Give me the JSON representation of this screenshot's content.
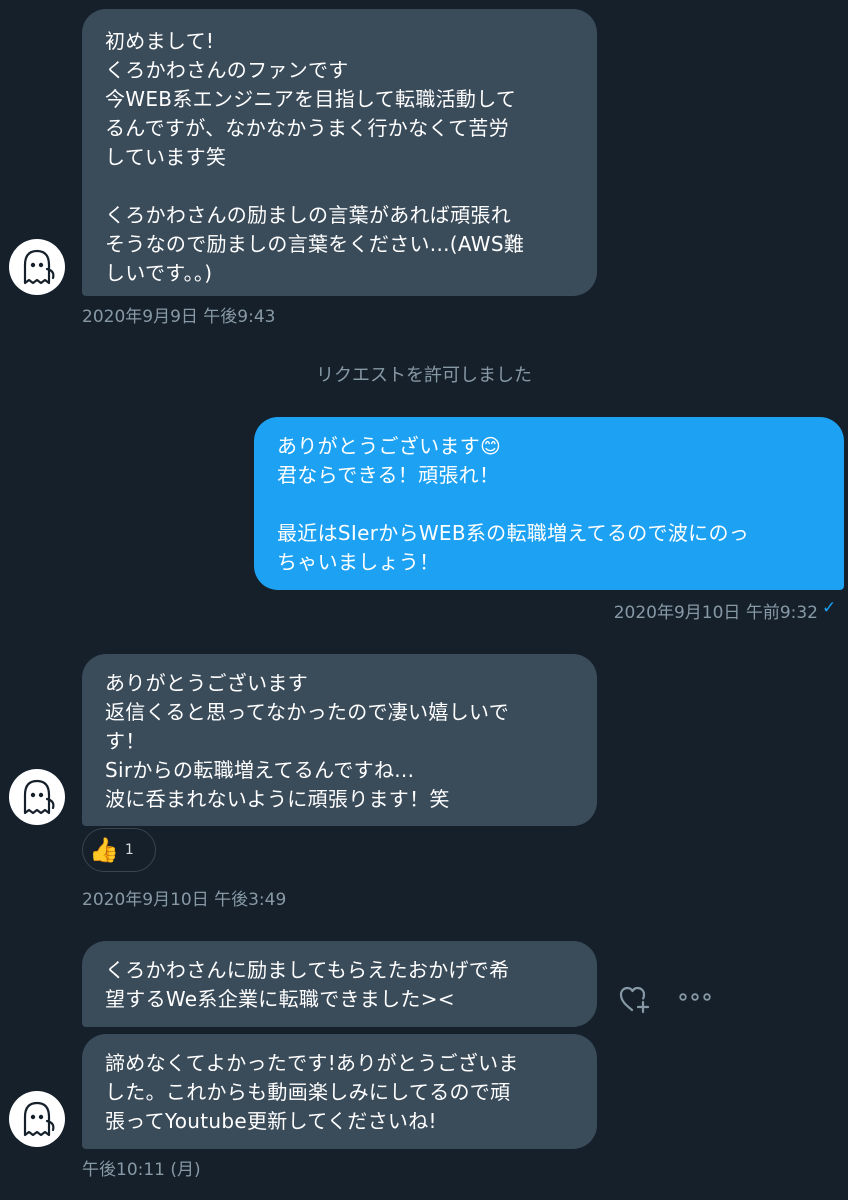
{
  "messages": {
    "m1": {
      "text": "初めまして!\nくろかわさんのファンです\n今WEB系エンジニアを目指して転職活動して\nるんですが、なかなかうまく行かなくて苦労\nしています笑\n\nくろかわさんの励ましの言葉があれば頑張れ\nそうなので励ましの言葉をください...(AWS難\nしいです。。)",
      "timestamp": "2020年9月9日 午後9:43"
    },
    "system_notice": "リクエストを許可しました",
    "m2": {
      "text": "ありがとうございます😊\n君ならできる！頑張れ！\n\n最近はSIerからWEB系の転職増えてるので波にのっ\nちゃいましょう！",
      "timestamp": "2020年9月10日 午前9:32",
      "read_mark": "✓"
    },
    "m3": {
      "text": "ありがとうございます\n返信くると思ってなかったので凄い嬉しいで\nす！\nSirからの転職増えてるんですね...\n波に呑まれないように頑張ります！笑",
      "reaction_emoji": "👍",
      "reaction_count": "1",
      "timestamp": "2020年9月10日 午後3:49"
    },
    "m4": {
      "text": "くろかわさんに励ましてもらえたおかげで希\n望するWe系企業に転職できました><"
    },
    "m5": {
      "text": "諦めなくてよかったです!ありがとうございま\nした。これからも動画楽しみにしてるので頑\n張ってYoutube更新してくださいね!",
      "timestamp": "午後10:11 (月)"
    }
  },
  "icons": {
    "avatar": "ghost-avatar-icon",
    "react": "heart-plus-icon",
    "more": "more-icon",
    "read": "read-check-icon"
  },
  "colors": {
    "background": "#15202b",
    "incoming_bubble": "#3a4b5a",
    "outgoing_bubble": "#1da1f2",
    "muted_text": "#8899a6"
  }
}
